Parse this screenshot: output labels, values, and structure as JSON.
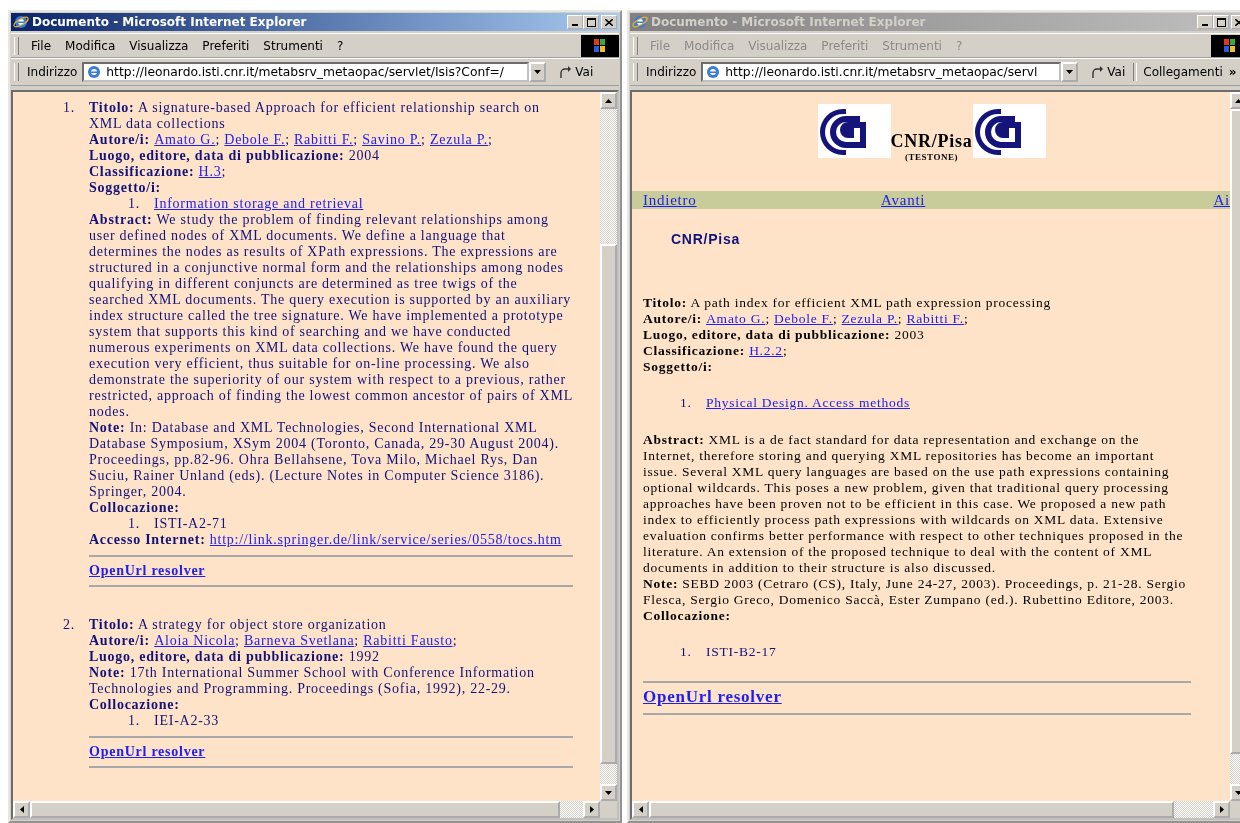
{
  "windows": [
    {
      "active": true,
      "title": "Documento - Microsoft Internet Explorer",
      "menu": [
        "File",
        "Modifica",
        "Visualizza",
        "Preferiti",
        "Strumenti",
        "?"
      ],
      "address": {
        "label": "Indirizzo",
        "url": "http://leonardo.isti.cnr.it/metabsrv_metaopac/servlet/Isis?Conf=/",
        "go": "Vai"
      },
      "page": {
        "kind": "results",
        "records": [
          {
            "number": "1.",
            "fields": [
              {
                "kind": "text",
                "text": "**Titolo:** A signature-based Approach for efficient relationship search on XML data collections"
              },
              {
                "kind": "links",
                "label": "Autore/i:",
                "sep": ";",
                "links": [
                  "Amato G.",
                  "Debole F.",
                  "Rabitti F.",
                  "Savino P.",
                  "Zezula P."
                ]
              },
              {
                "kind": "text",
                "text": "**Luogo, editore, data di pubblicazione:** 2004"
              },
              {
                "kind": "links",
                "label": "Classificazione:",
                "sep": ";",
                "links": [
                  "H.3"
                ]
              },
              {
                "kind": "list",
                "label": "Soggetto/i:",
                "items": [
                  {
                    "number": "1.",
                    "text": "Information storage and retrieval",
                    "link": true
                  }
                ]
              },
              {
                "kind": "text",
                "text": "**Abstract:** We study the problem of finding relevant relationships among user defined nodes of XML documents. We define a language that determines the nodes as results of XPath expressions. The expressions are structured in a conjunctive normal form and the relationships among nodes qualifying in different conjuncts are determined as tree twigs of the searched XML documents. The query execution is supported by an auxiliary index structure called the tree signature. We have implemented a prototype system that supports this kind of searching and we have conducted numerous experiments on XML data collections. We have found the query execution very efficient, thus suitable for on-line processing. We also demonstrate the superiority of our system with respect to a previous, rather restricted, approach of finding the lowest common ancestor of pairs of XML nodes."
              },
              {
                "kind": "text",
                "text": "**Note:** In: Database and XML Technologies, Second International XML Database Symposium, XSym 2004 (Toronto, Canada, 29-30 August 2004). Proceedings, pp.82-96. Ohra Bellahsene, Tova Milo, Michael Rys, Dan Suciu, Rainer Unland (eds). (Lecture Notes in Computer Science 3186). Springer, 2004."
              },
              {
                "kind": "list",
                "label": "Collocazione:",
                "items": [
                  {
                    "number": "1.",
                    "text": "ISTI-A2-71",
                    "link": false
                  }
                ]
              },
              {
                "kind": "url",
                "label": "Accesso Internet:",
                "url": "http://link.springer.de/link/service/series/0558/tocs.htm"
              }
            ],
            "resolver": "OpenUrl resolver"
          },
          {
            "number": "2.",
            "fields": [
              {
                "kind": "text",
                "text": "**Titolo:** A strategy for object store organization"
              },
              {
                "kind": "links",
                "label": "Autore/i:",
                "sep": ";",
                "links": [
                  "Aloia Nicola",
                  "Barneva Svetlana",
                  "Rabitti Fausto"
                ]
              },
              {
                "kind": "text",
                "text": "**Luogo, editore, data di pubblicazione:** 1992"
              },
              {
                "kind": "text",
                "text": "**Note:** 17th International Summer School with Conference Information Technologies and Programming. Proceedings (Sofia, 1992), 22-29."
              },
              {
                "kind": "list",
                "label": "Collocazione:",
                "items": [
                  {
                    "number": "1.",
                    "text": "IEI-A2-33",
                    "link": false
                  }
                ]
              }
            ],
            "resolver": "OpenUrl resolver"
          }
        ]
      }
    },
    {
      "active": false,
      "title": "Documento - Microsoft Internet Explorer",
      "menu": [
        "File",
        "Modifica",
        "Visualizza",
        "Preferiti",
        "Strumenti",
        "?"
      ],
      "address": {
        "label": "Indirizzo",
        "url": "http://leonardo.isti.cnr.it/metabsrv_metaopac/servl",
        "go": "Vai",
        "links_label": "Collegamenti",
        "chevron": "»"
      },
      "page": {
        "kind": "detail",
        "header": {
          "title": "CNR/Pisa",
          "subtitle": "(TESTONE)"
        },
        "nav": [
          "Indietro",
          "Avanti",
          "Ai"
        ],
        "heading": "CNR/Pisa",
        "records": [
          {
            "fields": [
              {
                "kind": "text",
                "text": "**Titolo:** A path index for efficient XML path expression processing"
              },
              {
                "kind": "links",
                "label": "Autore/i:",
                "sep": ";",
                "links": [
                  "Amato G.",
                  "Debole F.",
                  "Zezula P.",
                  "Rabitti F."
                ]
              },
              {
                "kind": "text",
                "text": "**Luogo, editore, data di pubblicazione:** 2003"
              },
              {
                "kind": "links",
                "label": "Classificazione:",
                "sep": ";",
                "links": [
                  "H.2.2"
                ]
              },
              {
                "kind": "list",
                "label": "Soggetto/i:",
                "items": [
                  {
                    "number": "1.",
                    "text": "Physical Design. Access methods",
                    "link": true
                  }
                ]
              },
              {
                "kind": "text",
                "text": "**Abstract:** XML is a de fact standard for data representation and exchange on the Internet, therefore storing and querying XML repositories has become an important issue. Several XML query languages are based on the use path expressions containing optional wildcards. This poses a new problem, given that traditional query processing approaches have been proven not to be efficient in this case. We proposed a new path index to efficiently process path expressions with wildcards on XML data. Extensive evaluation confirms better performance with respect to other techniques proposed in the literature. An extension of the proposed technique to deal with the content of XML documents in addition to their structure is also discussed."
              },
              {
                "kind": "text",
                "text": "**Note:** SEBD 2003 (Cetraro (CS), Italy, June 24-27, 2003). Proceedings, p. 21-28. Sergio Flesca, Sergio Greco, Domenico Saccà, Ester Zumpano (ed.). Rubettino Editore, 2003."
              },
              {
                "kind": "list",
                "label": "Collocazione:",
                "items": [
                  {
                    "number": "1.",
                    "text": "ISTI-B2-17",
                    "link": false
                  }
                ]
              }
            ],
            "resolver": "OpenUrl resolver"
          }
        ]
      }
    }
  ]
}
